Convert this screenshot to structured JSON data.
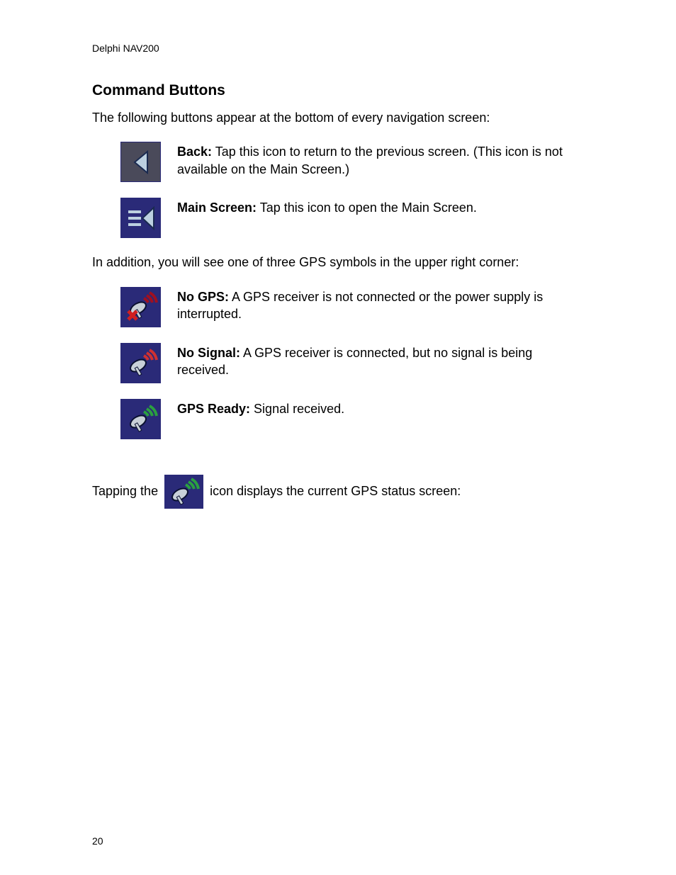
{
  "header": {
    "product": "Delphi NAV200"
  },
  "section": {
    "title": "Command Buttons",
    "intro": "The following buttons appear at the bottom of every navigation screen:"
  },
  "buttons": {
    "back": {
      "label": "Back:",
      "desc": " Tap this icon to return to the previous screen. (This icon is not available on the Main Screen.)"
    },
    "main": {
      "label": "Main Screen:",
      "desc": " Tap this icon to open the Main Screen."
    }
  },
  "gps_intro": "In addition, you will see one of three GPS symbols in the upper right corner:",
  "gps": {
    "no_gps": {
      "label": "No GPS:",
      "desc": " A GPS receiver is not connected or the power supply is interrupted."
    },
    "no_signal": {
      "label": "No Signal:",
      "desc": " A GPS receiver is connected, but no signal is being received."
    },
    "ready": {
      "label": "GPS Ready:",
      "desc": " Signal received."
    }
  },
  "tapping": {
    "before": "Tapping the ",
    "after": " icon displays the current GPS status screen:"
  },
  "page_number": "20"
}
